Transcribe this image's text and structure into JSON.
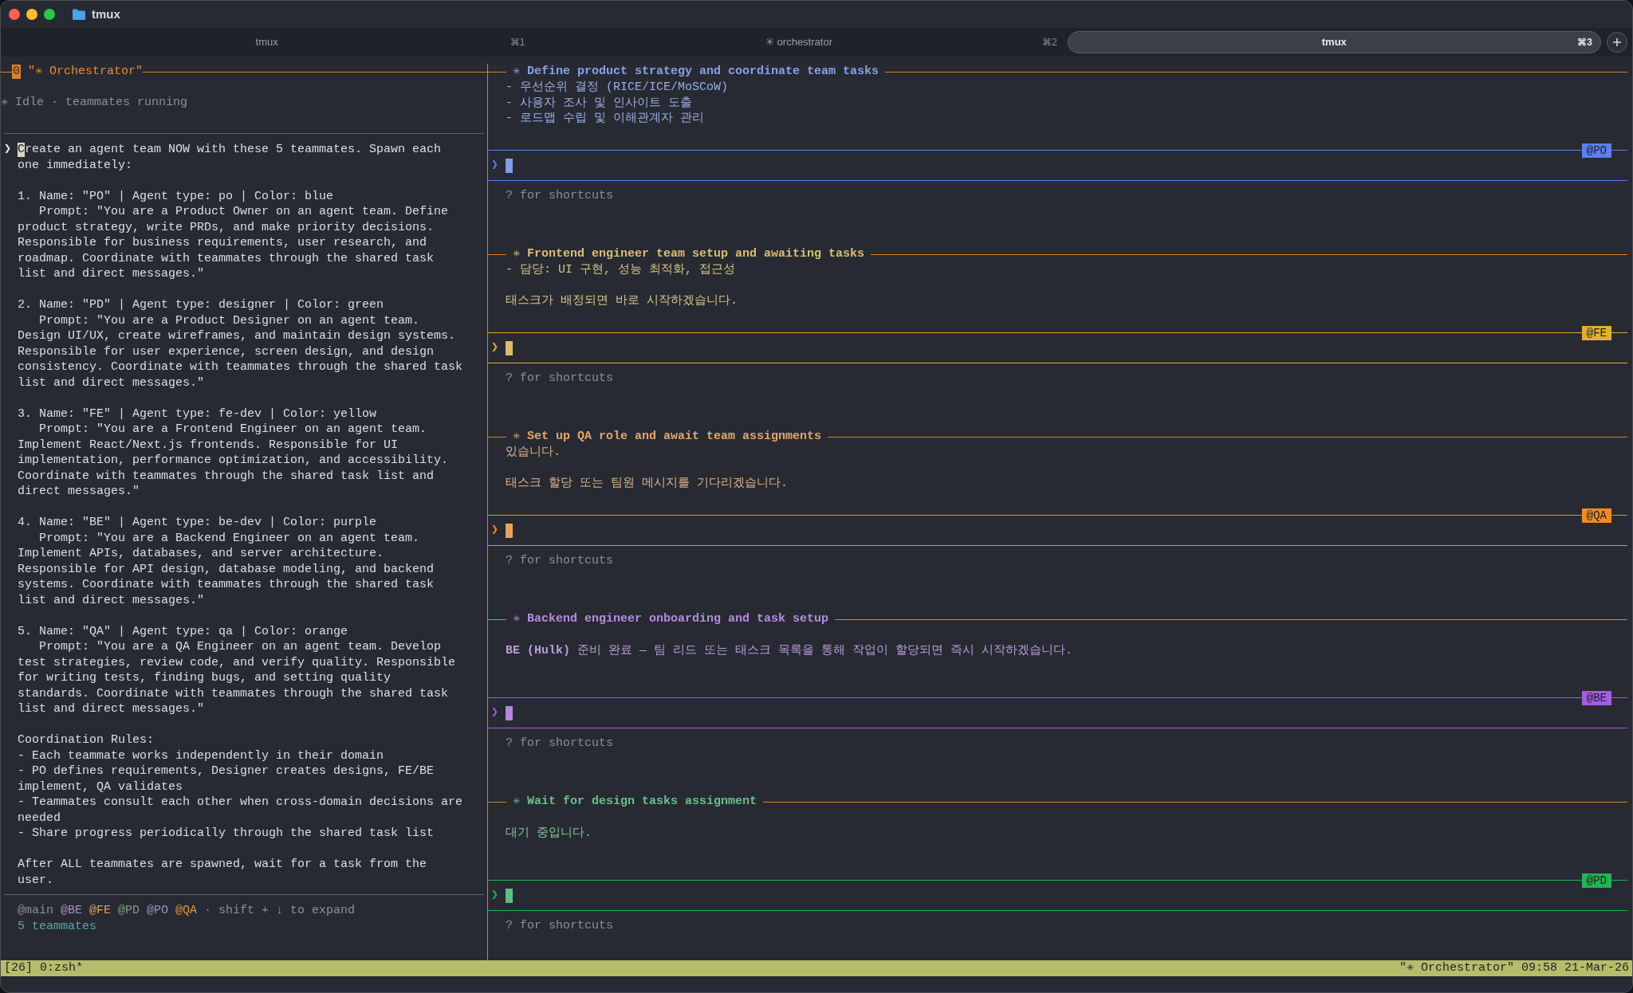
{
  "window": {
    "title": "tmux"
  },
  "tabs": [
    {
      "label": "tmux",
      "shortcut": "⌘1",
      "selected": false
    },
    {
      "label": "✳ orchestrator",
      "shortcut": "⌘2",
      "selected": false
    },
    {
      "label": "tmux",
      "shortcut": "⌘3",
      "selected": true
    }
  ],
  "left_pane": {
    "index": "0",
    "title": "\"✳ Orchestrator\"",
    "status": "✳ Idle · teammates running",
    "prompt_marker": "❯",
    "paragraphs": [
      [
        "Create an agent team NOW with these 5 teammates. Spawn each",
        "one immediately:"
      ],
      [
        "1. Name: \"PO\" | Agent type: po | Color: blue",
        "   Prompt: \"You are a Product Owner on an agent team. Define",
        "product strategy, write PRDs, and make priority decisions.",
        "Responsible for business requirements, user research, and",
        "roadmap. Coordinate with teammates through the shared task",
        "list and direct messages.\""
      ],
      [
        "2. Name: \"PD\" | Agent type: designer | Color: green",
        "   Prompt: \"You are a Product Designer on an agent team.",
        "Design UI/UX, create wireframes, and maintain design systems.",
        "Responsible for user experience, screen design, and design",
        "consistency. Coordinate with teammates through the shared task",
        "list and direct messages.\""
      ],
      [
        "3. Name: \"FE\" | Agent type: fe-dev | Color: yellow",
        "   Prompt: \"You are a Frontend Engineer on an agent team.",
        "Implement React/Next.js frontends. Responsible for UI",
        "implementation, performance optimization, and accessibility.",
        "Coordinate with teammates through the shared task list and",
        "direct messages.\""
      ],
      [
        "4. Name: \"BE\" | Agent type: be-dev | Color: purple",
        "   Prompt: \"You are a Backend Engineer on an agent team.",
        "Implement APIs, databases, and server architecture.",
        "Responsible for API design, database modeling, and backend",
        "systems. Coordinate with teammates through the shared task",
        "list and direct messages.\""
      ],
      [
        "5. Name: \"QA\" | Agent type: qa | Color: orange",
        "   Prompt: \"You are a QA Engineer on an agent team. Develop",
        "test strategies, review code, and verify quality. Responsible",
        "for writing tests, finding bugs, and setting quality",
        "standards. Coordinate with teammates through the shared task",
        "list and direct messages.\""
      ],
      [
        "Coordination Rules:",
        "- Each teammate works independently in their domain",
        "- PO defines requirements, Designer creates designs, FE/BE",
        "implement, QA validates",
        "- Teammates consult each other when cross-domain decisions are",
        "needed",
        "- Share progress periodically through the shared task list"
      ],
      [
        "After ALL teammates are spawned, wait for a task from the",
        "user."
      ]
    ],
    "mentions": [
      {
        "label": "@main",
        "color": "#8a8f98"
      },
      {
        "label": "@BE",
        "color": "#a98fc9"
      },
      {
        "label": "@FE",
        "color": "#e0a060"
      },
      {
        "label": "@PD",
        "color": "#7f9f86"
      },
      {
        "label": "@PO",
        "color": "#8a9cc0"
      },
      {
        "label": "@QA",
        "color": "#e8903a"
      }
    ],
    "hint": "· shift + ↓ to expand",
    "count": "5 teammates"
  },
  "agents": [
    {
      "title": "✳ Define product strategy and coordinate team tasks",
      "color": "#5b7ff0",
      "lead_blank": false,
      "paragraphs": [
        [
          "- 우선순위 결정 (RICE/ICE/MoSCoW)",
          "- 사용자 조사 및 인사이트 도출",
          "- 로드맵 수립 및 이해관계자 관리"
        ]
      ],
      "badge": "@PO",
      "prompt_marker": "❯",
      "shortcuts": "? for shortcuts"
    },
    {
      "title": "✳ Frontend engineer team setup and awaiting tasks",
      "color": "#e0b030",
      "lead_blank": false,
      "paragraphs": [
        [
          "- 담당: UI 구현, 성능 최적화, 접근성"
        ],
        [
          "태스크가 배정되면 바로 시작하겠습니다."
        ]
      ],
      "badge": "@FE",
      "prompt_marker": "❯",
      "shortcuts": "? for shortcuts"
    },
    {
      "title": "✳ Set up QA role and await team assignments",
      "color": "#f28a22",
      "lead_blank": false,
      "paragraphs": [
        [
          "있습니다."
        ],
        [
          "태스크 할당 또는 팀원 메시지를 기다리겠습니다."
        ]
      ],
      "badge": "@QA",
      "prompt_marker": "❯",
      "shortcuts": "? for shortcuts"
    },
    {
      "title": "✳ Backend engineer onboarding and task setup",
      "color": "#a35de0",
      "lead_blank": true,
      "paragraphs": [
        [
          "**BE (Hulk)** 준비 완료 — 팀 리드 또는 태스크 목록을 통해 작업이 할당되면 즉시 시작하겠습니다."
        ]
      ],
      "badge": "@BE",
      "prompt_marker": "❯",
      "shortcuts": "? for shortcuts"
    },
    {
      "title": "✳ Wait for design tasks assignment",
      "color": "#22b455",
      "lead_blank": true,
      "paragraphs": [
        [
          "대기 중입니다."
        ]
      ],
      "badge": "@PD",
      "prompt_marker": "❯",
      "shortcuts": "? for shortcuts"
    }
  ],
  "status_bar": {
    "left": "[26] 0:zsh*",
    "right": "\"✳ Orchestrator\" 09:58 21-Mar-26"
  }
}
